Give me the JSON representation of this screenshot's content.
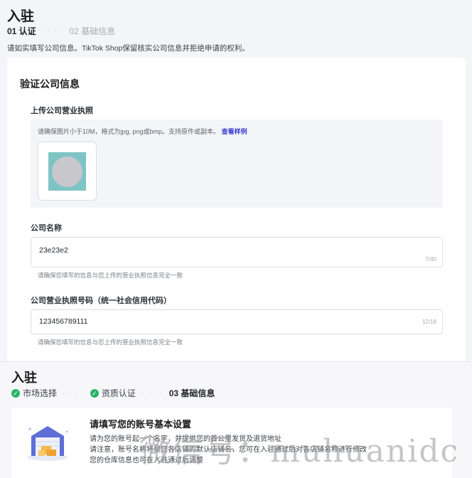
{
  "top": {
    "title": "入驻",
    "steps": [
      {
        "label": "01 认证",
        "state": "active"
      },
      {
        "label": "02 基础信息",
        "state": "inactive"
      }
    ],
    "step_separator": "· · · ·",
    "notice": "请如实填写公司信息。TikTok Shop保留核实公司信息并拒绝申请的权利。",
    "card": {
      "title": "验证公司信息",
      "upload": {
        "label": "上传公司营业执照",
        "hint": "请确保图片小于10M，格式为jpg, png或bmp。支持原件或副本。",
        "hint_link": "查看样例"
      },
      "company_name": {
        "label": "公司名称",
        "value": "23e23e2",
        "count": "7/40",
        "helper": "请确保您填写的信息与您上传的营业执照信息完全一致"
      },
      "license_number": {
        "label": "公司营业执照号码（统一社会信用代码）",
        "value": "123456789111",
        "count": "12/18",
        "helper": "请确保您填写的信息与您上传的营业执照信息完全一致"
      }
    }
  },
  "bottom": {
    "title": "入驻",
    "steps": [
      {
        "label": "市场选择",
        "state": "done"
      },
      {
        "label": "资质认证",
        "state": "done"
      },
      {
        "label": "03 基础信息",
        "state": "active"
      }
    ],
    "step_separator": "· · · ·",
    "card": {
      "title": "请填写您的账号基本设置",
      "line1": "请为您的账号起一个名字，并提供您的首公里发货及退货地址",
      "line2": "请注意，账号名称将是您各店铺的默认店铺名，您可在入驻通过后对各店铺名称进行修改",
      "line3": "您的仓库信息也可在入驻通过后调整"
    }
  },
  "watermark": "微信号：muhuanidc",
  "colors": {
    "accent_link": "#3a3fd0",
    "success": "#29b36a",
    "background": "#f4f5f8"
  }
}
